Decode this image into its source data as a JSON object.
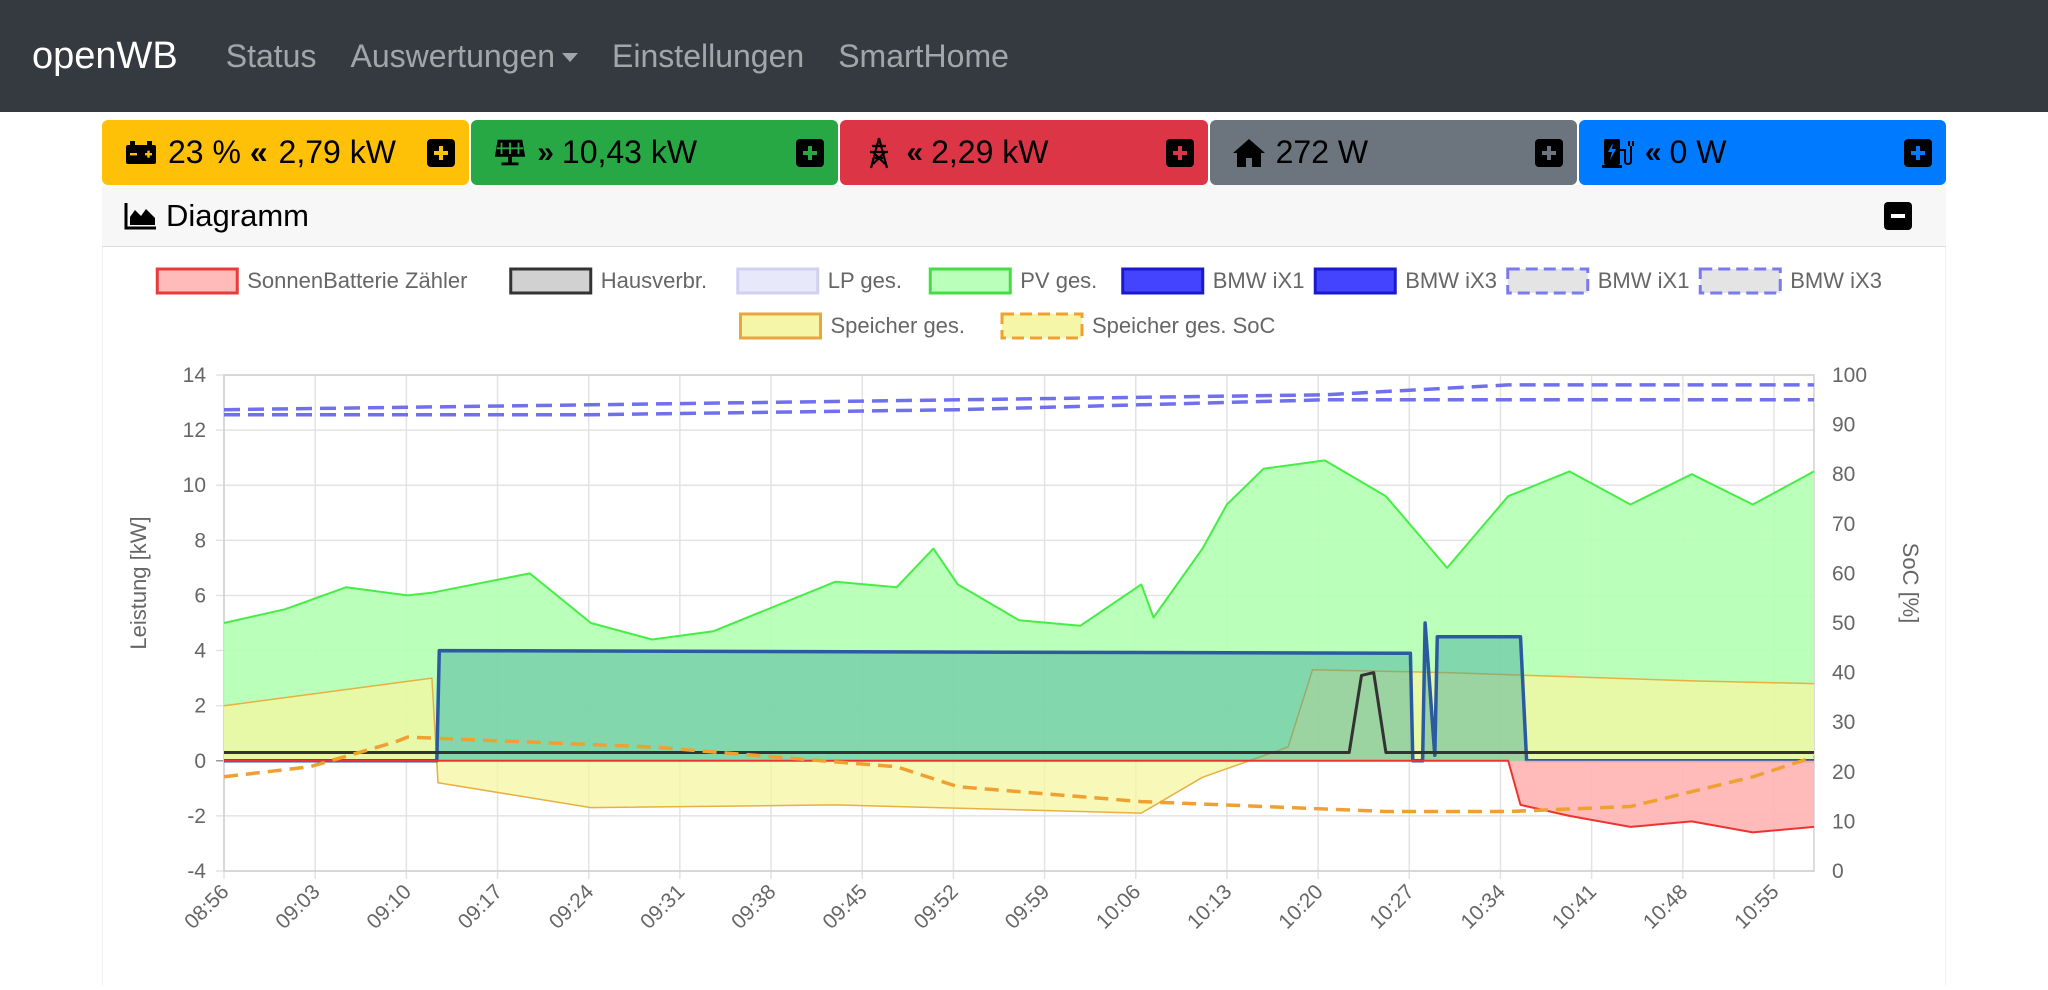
{
  "navbar": {
    "brand": "openWB",
    "links": [
      "Status",
      "Auswertungen",
      "Einstellungen",
      "SmartHome"
    ]
  },
  "tiles": [
    {
      "name": "battery",
      "icon": "battery-icon",
      "direction": "«",
      "value": "23 % « 2,79 kW",
      "text": "23 %",
      "power": "2,79 kW",
      "color": "#ffc107"
    },
    {
      "name": "pv",
      "icon": "solar-panel-icon",
      "direction": "»",
      "power": "10,43 kW",
      "color": "#28a745"
    },
    {
      "name": "grid",
      "icon": "power-tower-icon",
      "direction": "«",
      "power": "2,29 kW",
      "color": "#dc3545"
    },
    {
      "name": "house",
      "icon": "home-icon",
      "direction": "",
      "power": "272 W",
      "color": "#6c757d"
    },
    {
      "name": "charging",
      "icon": "charging-station-icon",
      "direction": "«",
      "power": "0 W",
      "color": "#007bff"
    }
  ],
  "diagram": {
    "title": "Diagramm",
    "icon": "area-chart-icon",
    "collapse_icon": "minus-icon"
  },
  "chart_data": {
    "type": "line",
    "ylabel_left": "Leistung [kW]",
    "ylabel_right": "SoC [%]",
    "ylim_left": [
      -4,
      14
    ],
    "ylim_right": [
      0,
      100
    ],
    "yticks_left": [
      "14",
      "12",
      "10",
      "8",
      "6",
      "4",
      "2",
      "0",
      "-2",
      "-4"
    ],
    "yticks_right": [
      "100",
      "90",
      "80",
      "70",
      "60",
      "50",
      "40",
      "30",
      "20",
      "10",
      "0"
    ],
    "x_ticks": [
      "08:56",
      "09:03",
      "09:10",
      "09:17",
      "09:24",
      "09:31",
      "09:38",
      "09:45",
      "09:52",
      "09:59",
      "10:06",
      "10:13",
      "10:20",
      "10:27",
      "10:34",
      "10:41",
      "10:48",
      "10:55"
    ],
    "legend_position": "top",
    "legend": [
      {
        "label": "SonnenBatterie Zähler",
        "fill": "#ffb3b3",
        "stroke": "#e83b3b",
        "dashed": false
      },
      {
        "label": "Hausverbr.",
        "fill": "#cccccc",
        "stroke": "#333333",
        "dashed": false
      },
      {
        "label": "LP ges.",
        "fill": "#e6e6fb",
        "stroke": "#d0d0f0",
        "dashed": false
      },
      {
        "label": "PV ges.",
        "fill": "#b3ffb3",
        "stroke": "#44dd44",
        "dashed": false
      },
      {
        "label": "BMW iX1",
        "fill": "#4444ff",
        "stroke": "#1a1acc",
        "dashed": false
      },
      {
        "label": "BMW iX3",
        "fill": "#4444ff",
        "stroke": "#1a1acc",
        "dashed": false
      },
      {
        "label": "BMW iX1",
        "fill": "#dddddd",
        "stroke": "#7a7aee",
        "dashed": true
      },
      {
        "label": "BMW iX3",
        "fill": "#dddddd",
        "stroke": "#7a7aee",
        "dashed": true
      },
      {
        "label": "Speicher ges.",
        "fill": "#f5f5a0",
        "stroke": "#e8a640",
        "dashed": false
      },
      {
        "label": "Speicher ges. SoC",
        "fill": "#f5f5a0",
        "stroke": "#f0a030",
        "dashed": true
      }
    ],
    "series": [
      {
        "name": "PV ges.",
        "x": [
          0,
          5,
          10,
          15,
          17,
          25,
          30,
          35,
          40,
          45,
          50,
          55,
          58,
          60,
          65,
          70,
          75,
          76,
          80,
          82,
          85,
          90,
          95,
          100,
          105,
          110,
          115,
          120,
          125,
          130
        ],
        "y": [
          5.0,
          5.5,
          6.3,
          6.0,
          6.1,
          6.8,
          5.0,
          4.4,
          4.7,
          5.6,
          6.5,
          6.3,
          7.7,
          6.4,
          5.1,
          4.9,
          6.4,
          5.2,
          7.7,
          9.3,
          10.6,
          10.9,
          9.6,
          7.0,
          9.6,
          10.5,
          9.3,
          10.4,
          9.3,
          10.5
        ]
      },
      {
        "name": "Speicher ges.",
        "x": [
          0,
          17,
          17.5,
          30,
          50,
          75,
          80,
          87,
          89,
          100,
          120,
          130
        ],
        "y": [
          2.0,
          3.0,
          -0.8,
          -1.7,
          -1.6,
          -1.9,
          -0.6,
          0.5,
          3.3,
          3.2,
          2.9,
          2.8
        ]
      },
      {
        "name": "BMW iX3",
        "x": [
          0,
          17.4,
          17.6,
          97,
          97.2,
          98,
          98.2,
          99,
          99.2,
          106,
          106.5,
          130
        ],
        "y": [
          0,
          0,
          4.0,
          3.9,
          0,
          0,
          5.0,
          0.2,
          4.5,
          4.5,
          0,
          0
        ]
      },
      {
        "name": "SonnenBatterie Zähler",
        "x": [
          0,
          105,
          106,
          110,
          115,
          120,
          125,
          130
        ],
        "y": [
          0,
          0,
          -1.6,
          -2.0,
          -2.4,
          -2.2,
          -2.6,
          -2.4
        ]
      },
      {
        "name": "Hausverbr.",
        "x": [
          0,
          40,
          80,
          92,
          93,
          94,
          95,
          96,
          100,
          130
        ],
        "y": [
          0.3,
          0.3,
          0.3,
          0.3,
          3.1,
          3.2,
          0.3,
          0.3,
          0.3,
          0.3
        ]
      },
      {
        "name": "Speicher ges. SoC",
        "x": [
          0,
          7,
          14,
          15,
          35,
          55,
          60,
          75,
          85,
          95,
          105,
          115,
          125,
          130
        ],
        "y": [
          19,
          21,
          26,
          27,
          25,
          21,
          17,
          14,
          13,
          12,
          12,
          13,
          19,
          23
        ]
      },
      {
        "name": "BMW iX1 SoC",
        "x": [
          0,
          30,
          60,
          90,
          105,
          130
        ],
        "y": [
          93,
          94,
          95,
          96,
          98,
          98
        ]
      },
      {
        "name": "BMW iX3 SoC",
        "x": [
          0,
          30,
          60,
          90,
          105,
          130
        ],
        "y": [
          92,
          92,
          93,
          95,
          95,
          95
        ]
      }
    ]
  }
}
